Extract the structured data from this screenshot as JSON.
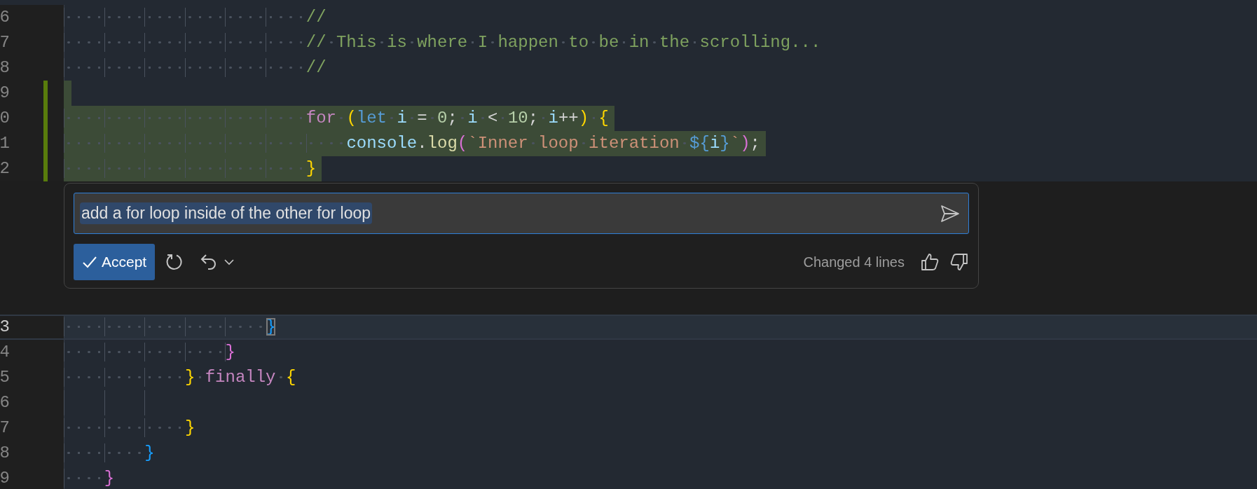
{
  "editor_top": {
    "lines": [
      {
        "number": "6",
        "current": false,
        "inserted": false,
        "code": [
          {
            "text": "                        //",
            "kind": "comment"
          }
        ]
      },
      {
        "number": "7",
        "current": false,
        "inserted": false,
        "code": [
          {
            "text": "                        // This is where I happen to be in the scrolling...",
            "kind": "comment"
          }
        ]
      },
      {
        "number": "8",
        "current": false,
        "inserted": false,
        "code": [
          {
            "text": "                        //",
            "kind": "comment"
          }
        ]
      },
      {
        "number": "9",
        "current": false,
        "inserted": true
      },
      {
        "number": "0",
        "current": false,
        "inserted": true,
        "code": [
          {
            "text": "                        for",
            "kind": "control"
          },
          {
            "text": " (",
            "kind": "bracket-yellow"
          },
          {
            "text": "let",
            "kind": "storage"
          },
          {
            "text": " i",
            "kind": "variable"
          },
          {
            "text": " = ",
            "kind": "plain"
          },
          {
            "text": "0",
            "kind": "number"
          },
          {
            "text": "; ",
            "kind": "plain"
          },
          {
            "text": "i",
            "kind": "variable"
          },
          {
            "text": " < ",
            "kind": "plain"
          },
          {
            "text": "10",
            "kind": "number"
          },
          {
            "text": "; ",
            "kind": "plain"
          },
          {
            "text": "i",
            "kind": "variable"
          },
          {
            "text": "++",
            "kind": "plain"
          },
          {
            "text": ")",
            "kind": "bracket-yellow"
          },
          {
            "text": " {",
            "kind": "bracket-yellow"
          }
        ]
      },
      {
        "number": "1",
        "current": false,
        "inserted": true,
        "code": [
          {
            "text": "                            console",
            "kind": "variable"
          },
          {
            "text": ".",
            "kind": "plain"
          },
          {
            "text": "log",
            "kind": "function"
          },
          {
            "text": "(",
            "kind": "bracket-magenta"
          },
          {
            "text": "`Inner loop iteration ",
            "kind": "string"
          },
          {
            "text": "${",
            "kind": "storage"
          },
          {
            "text": "i",
            "kind": "variable"
          },
          {
            "text": "}",
            "kind": "storage"
          },
          {
            "text": "`",
            "kind": "string"
          },
          {
            "text": ")",
            "kind": "bracket-magenta"
          },
          {
            "text": ";",
            "kind": "plain"
          }
        ]
      },
      {
        "number": "2",
        "current": false,
        "inserted": true,
        "code": [
          {
            "text": "                        }",
            "kind": "bracket-yellow"
          }
        ]
      }
    ]
  },
  "inline_chat": {
    "prompt": {
      "value": "add a for loop inside of the other for loop",
      "text_selected": true
    },
    "accept_button": "Accept",
    "summary": "Changed 4 lines"
  },
  "editor_bottom": {
    "lines": [
      {
        "number": "3",
        "current": true,
        "inserted": false,
        "code": [
          {
            "text": "                    }",
            "kind": "matched-bracket"
          }
        ]
      },
      {
        "number": "4",
        "current": false,
        "inserted": false,
        "code": [
          {
            "text": "                }",
            "kind": "bracket-magenta"
          }
        ]
      },
      {
        "number": "5",
        "current": false,
        "inserted": false,
        "code": [
          {
            "text": "            }",
            "kind": "bracket-yellow"
          },
          {
            "text": " finally",
            "kind": "control"
          },
          {
            "text": " {",
            "kind": "bracket-yellow"
          }
        ]
      },
      {
        "number": "6",
        "current": false,
        "inserted": false
      },
      {
        "number": "7",
        "current": false,
        "inserted": false,
        "code": [
          {
            "text": "            }",
            "kind": "bracket-yellow"
          }
        ]
      },
      {
        "number": "8",
        "current": false,
        "inserted": false,
        "code": [
          {
            "text": "        }",
            "kind": "bracket-blue"
          }
        ]
      },
      {
        "number": "9",
        "current": false,
        "inserted": false,
        "code": [
          {
            "text": "    }",
            "kind": "bracket-magenta"
          }
        ]
      }
    ]
  }
}
